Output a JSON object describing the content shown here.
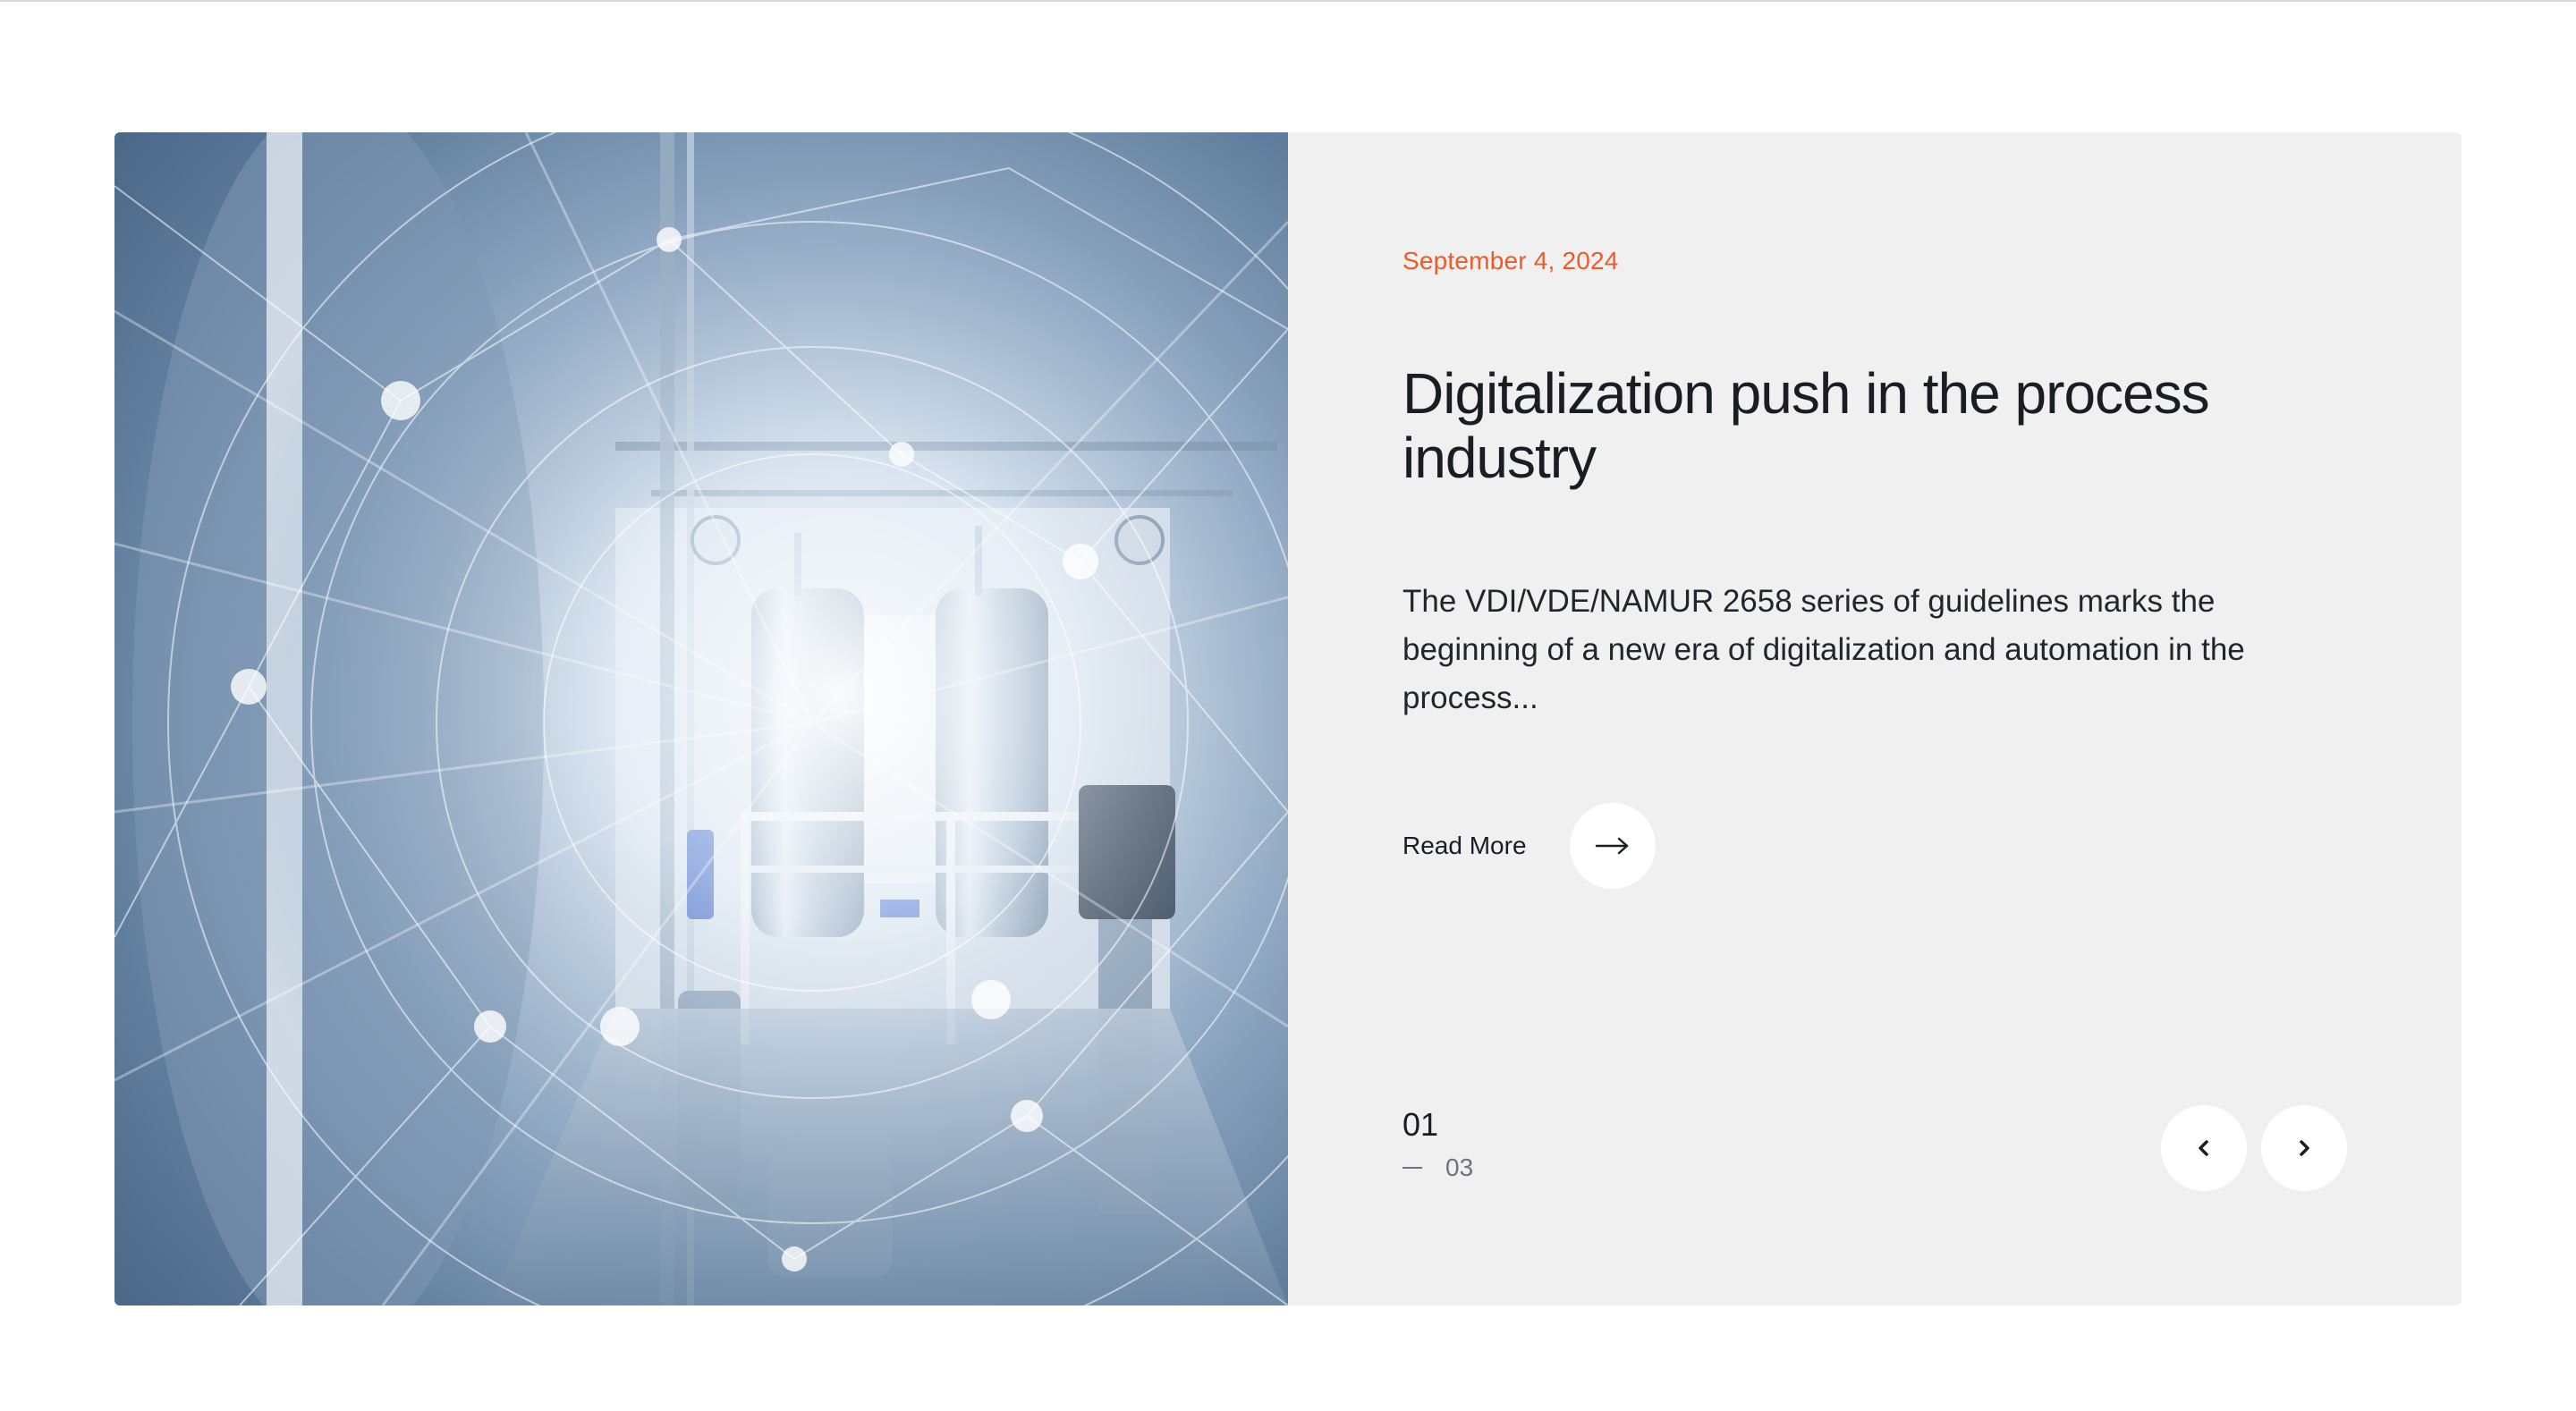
{
  "article": {
    "date": "September 4, 2024",
    "title": "Digitalization push in the process industry",
    "excerpt": "The VDI/VDE/NAMUR 2658 series of guidelines marks the beginning of a new era of digitalization and automation in the process...",
    "read_more_label": "Read More",
    "image_description": "process-plant-image"
  },
  "slider": {
    "current": "01",
    "total": "03"
  },
  "icons": {
    "read_more": "arrow-right-icon",
    "prev": "chevron-left-icon",
    "next": "chevron-right-icon"
  },
  "colors": {
    "accent": "#f05a28",
    "card_background": "#f0f0f0",
    "text": "#1b1d24"
  }
}
